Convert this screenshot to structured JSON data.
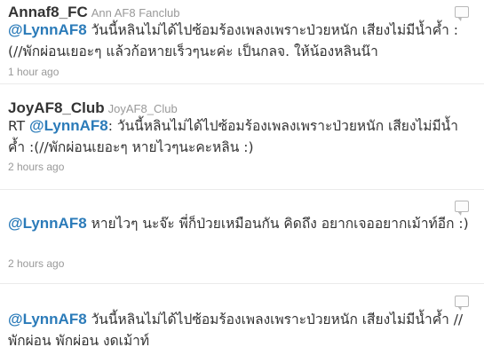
{
  "tweets": [
    {
      "screen_name": "Annaf8_FC",
      "full_name": "Ann AF8 Fanclub",
      "prefix": "",
      "mention": "@LynnAF8",
      "text": " วันนี้หลินไม่ได้ไปซ้อมร้องเพลงเพราะป่วยหนัก เสียงไม่มีน้ำค้ำ :(//พักผ่อนเยอะๆ แล้วก้อหายเร็วๆนะค่ะ เป็นกลจ. ให้น้องหลินน๊า",
      "time": "1 hour ago"
    },
    {
      "screen_name": "JoyAF8_Club",
      "full_name": "JoyAF8_Club",
      "prefix": "RT ",
      "mention": "@LynnAF8",
      "text": ": วันนี้หลินไม่ได้ไปซ้อมร้องเพลงเพราะป่วยหนัก เสียงไม่มีน้ำค้ำ :(//พักผ่อนเยอะๆ หายไวๆนะคะหลิน :)",
      "time": "2 hours ago"
    },
    {
      "screen_name": "",
      "full_name": "",
      "prefix": "",
      "mention": "@LynnAF8",
      "text": " หายไวๆ นะจ๊ะ พี่ก็ป่วยเหมือนกัน คิดถึง อยากเจออยากเม้าท์อีก :)",
      "time": "2 hours ago"
    },
    {
      "screen_name": "",
      "full_name": "",
      "prefix": "",
      "mention": "@LynnAF8",
      "text": " วันนี้หลินไม่ได้ไปซ้อมร้องเพลงเพราะป่วยหนัก เสียงไม่มีน้ำค้ำ // พักผ่อน พักผ่อน งดเม้าท์",
      "time": ""
    }
  ],
  "icons": {
    "reply": "reply-bubble-icon"
  },
  "colors": {
    "mention": "#2b7bb9",
    "meta": "#999999",
    "text": "#333333"
  }
}
